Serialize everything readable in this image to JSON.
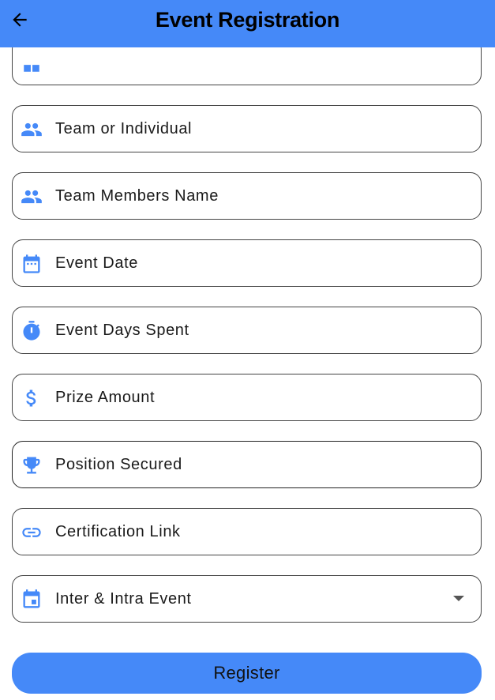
{
  "appbar": {
    "title": "Event Registration",
    "back_icon": "arrow-back-icon"
  },
  "form": {
    "partial_field": {
      "icon": "category-icon"
    },
    "fields": [
      {
        "label": "Team or Individual",
        "icon": "people-icon"
      },
      {
        "label": "Team Members Name",
        "icon": "people-icon"
      },
      {
        "label": "Event Date",
        "icon": "calendar-icon"
      },
      {
        "label": "Event Days Spent",
        "icon": "timer-icon"
      },
      {
        "label": "Prize Amount",
        "icon": "dollar-icon"
      },
      {
        "label": "Position Secured",
        "icon": "trophy-icon"
      },
      {
        "label": "Certification Link",
        "icon": "link-icon"
      }
    ],
    "dropdown": {
      "selected": "Inter & Intra Event",
      "icon": "event-calendar-icon"
    }
  },
  "register_label": "Register",
  "colors": {
    "accent": "#4589f8",
    "icon": "#4589f8",
    "border": "#444444"
  }
}
